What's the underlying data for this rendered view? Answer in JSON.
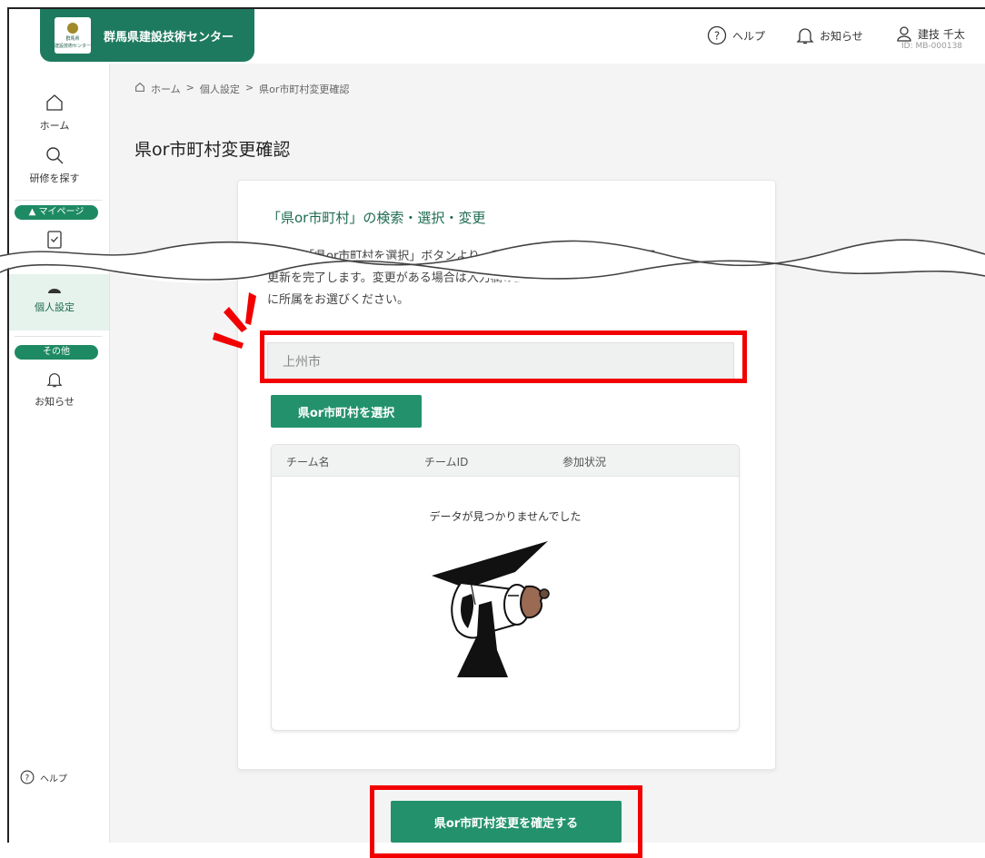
{
  "header": {
    "brand_name": "群馬県建設技術センター",
    "logo_line1": "群馬県",
    "logo_line2": "建設技術センター",
    "help_label": "ヘルプ",
    "notice_label": "お知らせ",
    "user_name": "建技 千太",
    "user_id": "ID: MB-000138"
  },
  "sidebar": {
    "home": "ホーム",
    "search": "研修を探す",
    "mypage_badge": "▲ マイページ",
    "personal": "個人設定",
    "other_badge": "その他",
    "notice": "お知らせ",
    "help": "ヘルプ"
  },
  "breadcrumb": [
    "ホーム",
    "個人設定",
    "県or市町村変更確認"
  ],
  "breadcrumb_sep": ">",
  "page_title": "県or市町村変更確認",
  "card": {
    "title": "「県or市町村」の検索・選択・変更",
    "desc_line1": "下記の「県or市町村を選択」ボタンより、所属を選択していただき、選択",
    "desc_line2": "更新を完了します。変更がある場合は入力欄の上で、",
    "desc_line3": "に所属をお選びください。",
    "input_value": "上州市",
    "select_button": "県or市町村を選択",
    "table_headers": [
      "チーム名",
      "チームID",
      "参加状況"
    ],
    "empty_message": "データが見つかりませんでした"
  },
  "confirm_button": "県or市町村変更を確定する",
  "colors": {
    "brand": "#1e7a5e",
    "button": "#23926c",
    "highlight": "#f20000"
  }
}
